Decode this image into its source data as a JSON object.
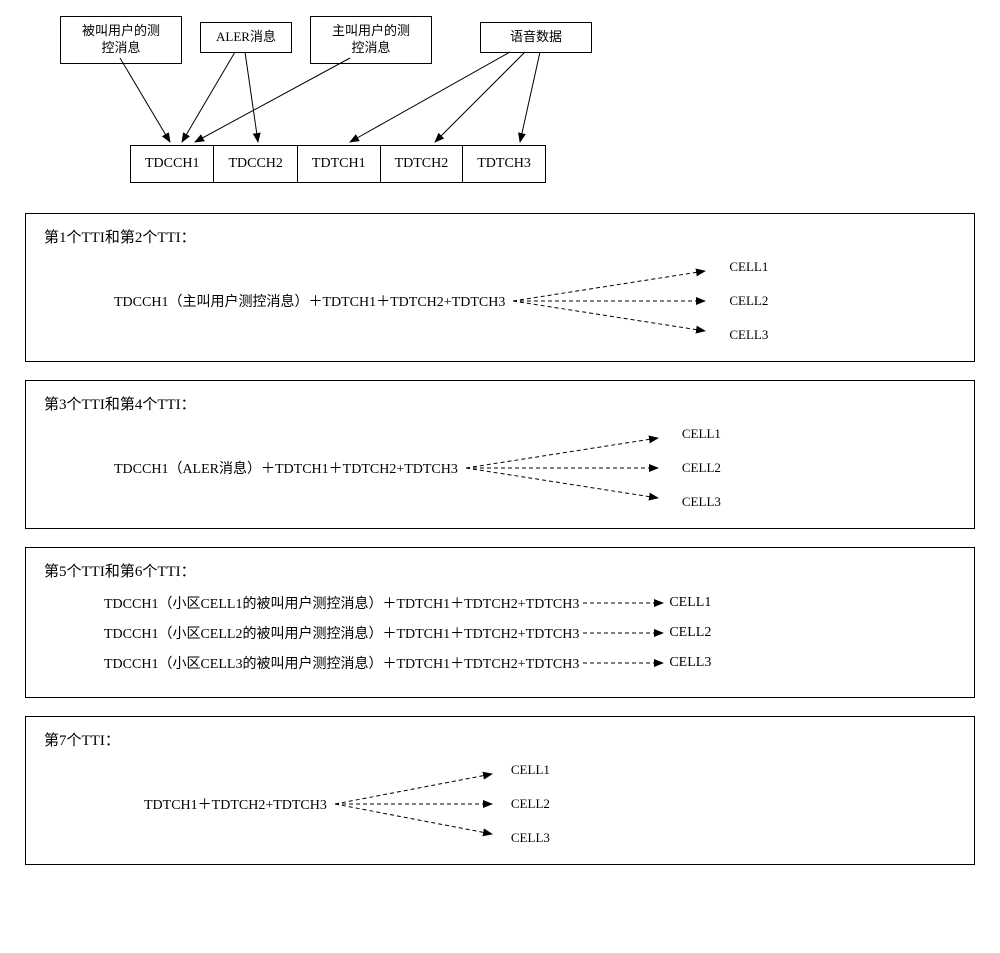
{
  "sources": {
    "s1": "被叫用户的测\n控消息",
    "s2": "ALER消息",
    "s3": "主叫用户的测\n控消息",
    "s4": "语音数据"
  },
  "channels": {
    "c1": "TDCCH1",
    "c2": "TDCCH2",
    "c3": "TDTCH1",
    "c4": "TDTCH2",
    "c5": "TDTCH3"
  },
  "panel1": {
    "title": "第1个TTI和第2个TTI：",
    "expr": "TDCCH1（主叫用户测控消息）＋TDTCH1＋TDTCH2+TDTCH3",
    "cells": {
      "a": "CELL1",
      "b": "CELL2",
      "c": "CELL3"
    }
  },
  "panel2": {
    "title": "第3个TTI和第4个TTI：",
    "expr": "TDCCH1（ALER消息）＋TDTCH1＋TDTCH2+TDTCH3",
    "cells": {
      "a": "CELL1",
      "b": "CELL2",
      "c": "CELL3"
    }
  },
  "panel3": {
    "title": "第5个TTI和第6个TTI：",
    "rows": {
      "r1": {
        "expr": "TDCCH1（小区CELL1的被叫用户测控消息）＋TDTCH1＋TDTCH2+TDTCH3",
        "cell": "CELL1"
      },
      "r2": {
        "expr": "TDCCH1（小区CELL2的被叫用户测控消息）＋TDTCH1＋TDTCH2+TDTCH3",
        "cell": "CELL2"
      },
      "r3": {
        "expr": "TDCCH1（小区CELL3的被叫用户测控消息）＋TDTCH1＋TDTCH2+TDTCH3",
        "cell": "CELL3"
      }
    }
  },
  "panel4": {
    "title": "第7个TTI：",
    "expr": "TDTCH1＋TDTCH2+TDTCH3",
    "cells": {
      "a": "CELL1",
      "b": "CELL2",
      "c": "CELL3"
    }
  }
}
